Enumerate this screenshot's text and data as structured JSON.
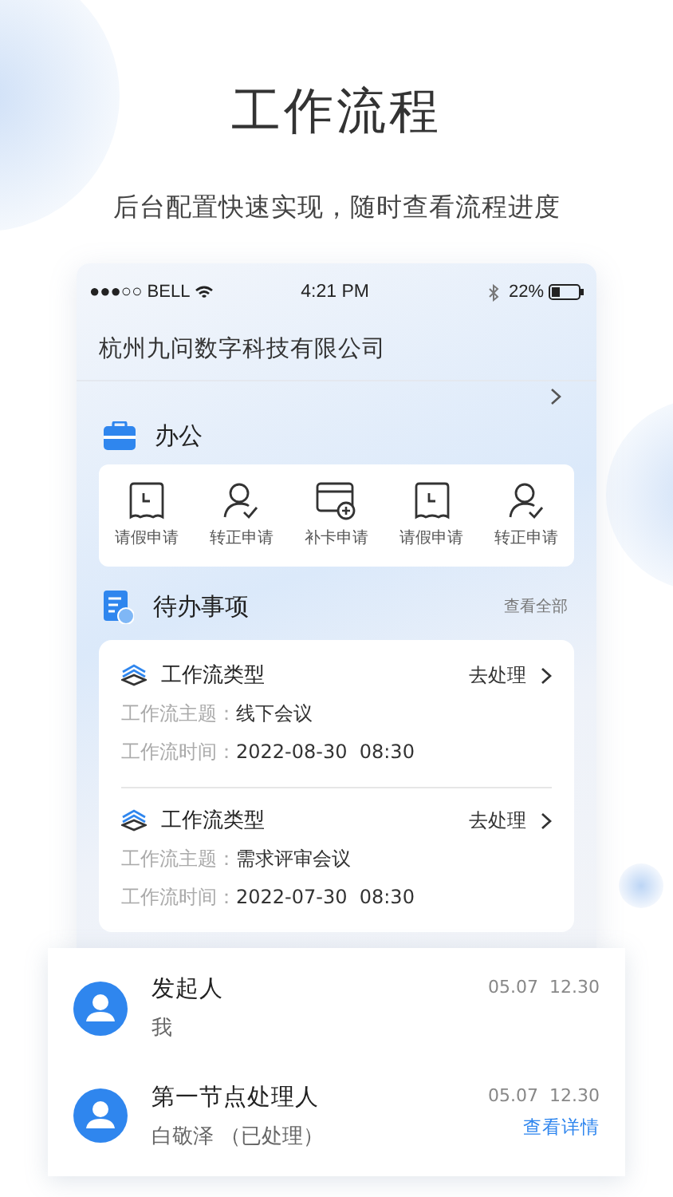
{
  "header": {
    "title": "工作流程",
    "subtitle": "后台配置快速实现，随时查看流程进度"
  },
  "phone": {
    "status_bar": {
      "carrier": "●●●○○ BELL",
      "time": "4:21 PM",
      "battery": "22%"
    },
    "company": "杭州九问数字科技有限公司",
    "office": {
      "title": "办公",
      "shortcuts": [
        {
          "kind": "leave",
          "label": "请假申请"
        },
        {
          "kind": "person",
          "label": "转正申请"
        },
        {
          "kind": "card",
          "label": "补卡申请"
        },
        {
          "kind": "leave",
          "label": "请假申请"
        },
        {
          "kind": "person",
          "label": "转正申请"
        }
      ]
    },
    "todo": {
      "title": "待办事项",
      "view_all": "查看全部",
      "items": [
        {
          "type": "工作流类型",
          "action": "去处理",
          "fields": [
            {
              "label": "工作流主题：",
              "value": "线下会议"
            },
            {
              "label": "工作流时间：",
              "value": "2022-08-30  08:30"
            }
          ]
        },
        {
          "type": "工作流类型",
          "action": "去处理",
          "fields": [
            {
              "label": "工作流主题：",
              "value": "需求评审会议"
            },
            {
              "label": "工作流时间：",
              "value": "2022-07-30  08:30"
            }
          ]
        }
      ]
    }
  },
  "approvers": [
    {
      "role": "发起人",
      "name": "我",
      "time": "05.07  12.30"
    },
    {
      "role": "第一节点处理人",
      "name": "白敬泽 （已处理）",
      "time": "05.07  12.30",
      "link": "查看详情"
    }
  ]
}
